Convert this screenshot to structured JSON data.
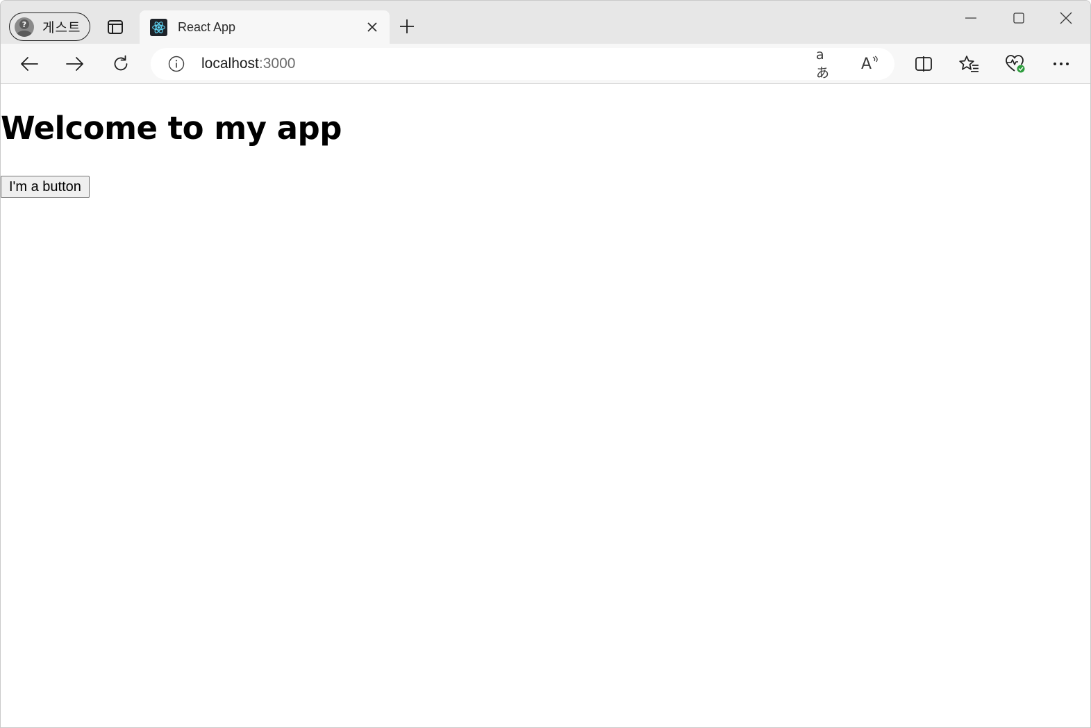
{
  "browser": {
    "profile": {
      "label": "게스트",
      "icon": "guest-avatar-icon"
    },
    "tab": {
      "title": "React App",
      "favicon": "react-logo-icon"
    },
    "address_bar": {
      "host": "localhost",
      "port": ":3000"
    },
    "icons": {
      "translate": "aあ",
      "read_aloud": "A",
      "accent_favicon": "#61dafb",
      "health_badge": "#2e9d3e"
    }
  },
  "page": {
    "heading": "Welcome to my app",
    "button_label": "I'm a button"
  }
}
